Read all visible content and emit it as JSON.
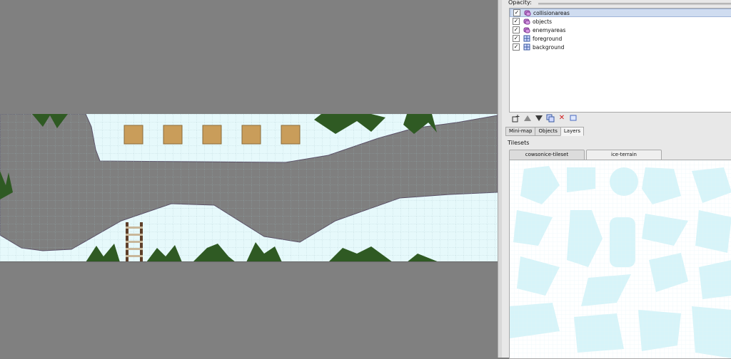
{
  "map": {
    "colors": {
      "ground": "#7f7f7f",
      "sky": "#e6f9fb",
      "grid": "#9ec6cc",
      "crate": "#c99d5a",
      "ladder": "#5e3f2a",
      "plant": "#2f5a23"
    }
  },
  "layers_panel": {
    "opacity_label": "Opacity:",
    "layers": [
      {
        "name": "collisionareas",
        "icon": "object-layer-icon",
        "visible": true,
        "selected": true
      },
      {
        "name": "objects",
        "icon": "object-layer-icon",
        "visible": true,
        "selected": false
      },
      {
        "name": "enemyareas",
        "icon": "object-layer-icon",
        "visible": true,
        "selected": false
      },
      {
        "name": "foreground",
        "icon": "tile-layer-icon",
        "visible": true,
        "selected": false
      },
      {
        "name": "background",
        "icon": "tile-layer-icon",
        "visible": true,
        "selected": false
      }
    ],
    "tabs": [
      "Mini-map",
      "Objects",
      "Layers"
    ],
    "active_tab": "Layers"
  },
  "tilesets_panel": {
    "label": "Tilesets",
    "tabs": [
      "cowsonice-tileset",
      "ice-terrain"
    ],
    "active_tab": "ice-terrain",
    "tile_color": "#d7f4f9"
  }
}
